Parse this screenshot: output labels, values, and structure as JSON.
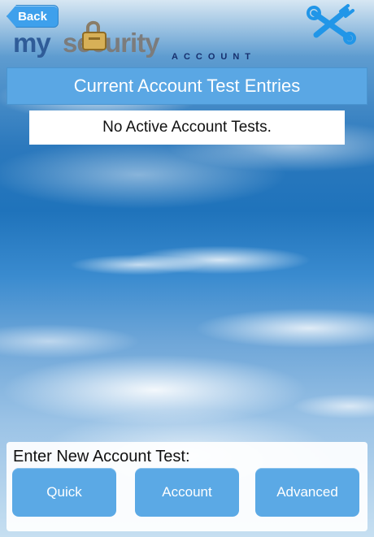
{
  "header": {
    "back_label": "Back",
    "logo": {
      "my": "my",
      "security": "security",
      "account": "ACCOUNT"
    }
  },
  "entries": {
    "title": "Current Account Test Entries",
    "empty_message": "No Active Account Tests."
  },
  "new_test": {
    "label": "Enter New Account Test:",
    "buttons": {
      "quick": "Quick",
      "account": "Account",
      "advanced": "Advanced"
    }
  },
  "icons": {
    "back": "back-chevron",
    "tools": "wrench-screwdriver-icon",
    "lock": "padlock-icon"
  },
  "colors": {
    "accent": "#5aa7e4",
    "button": "#5ba9e5",
    "back_button": "#3ea0ec",
    "logo_my": "#2f5c98",
    "logo_security": "#7c7c7c",
    "logo_account": "#17306e"
  }
}
